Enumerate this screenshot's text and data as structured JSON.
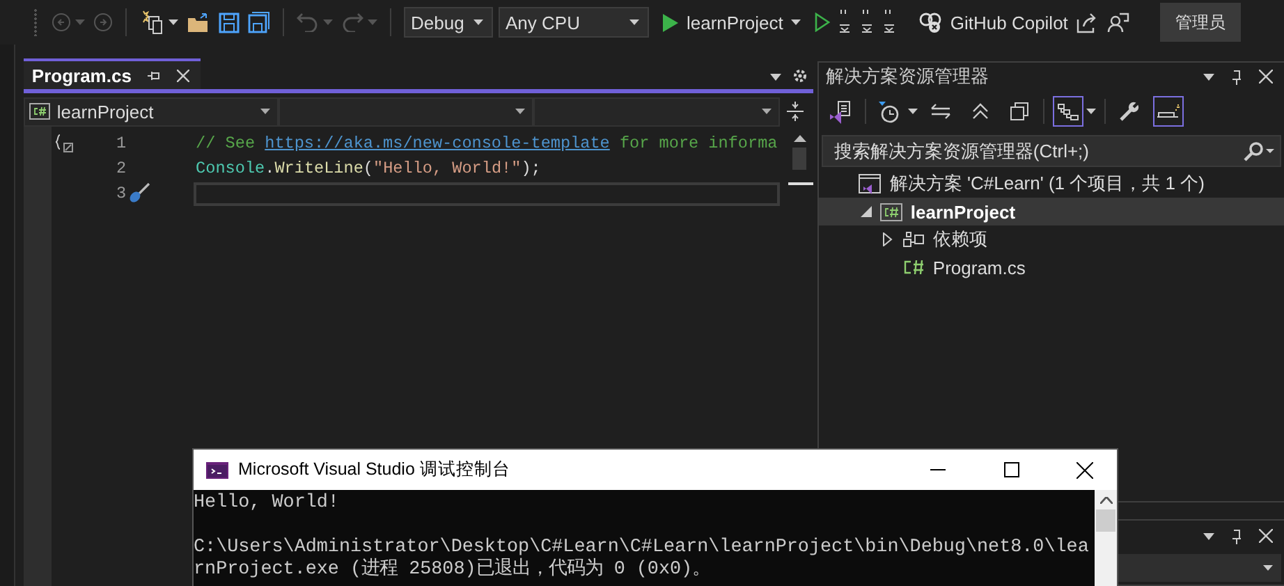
{
  "toolbar": {
    "back_disabled": true,
    "forward_disabled": true,
    "undo_disabled": true,
    "redo_disabled": true,
    "configuration": "Debug",
    "platform": "Any CPU",
    "startup": "learnProject",
    "copilot": "GitHub Copilot",
    "account": "管理员"
  },
  "editor": {
    "tabs": [
      {
        "label": "Program.cs",
        "selected": true
      }
    ],
    "nav": {
      "project": "learnProject"
    },
    "lines": [
      {
        "number": "1",
        "tokens": [
          {
            "text": "// See ",
            "kind": "comment"
          },
          {
            "text": "https://aka.ms/new-console-template",
            "kind": "link"
          },
          {
            "text": " for more informa",
            "kind": "comment"
          }
        ]
      },
      {
        "number": "2",
        "tokens": [
          {
            "text": "Console",
            "kind": "type"
          },
          {
            "text": ".",
            "kind": "plain"
          },
          {
            "text": "WriteLine",
            "kind": "method"
          },
          {
            "text": "(",
            "kind": "plain"
          },
          {
            "text": "\"Hello, World!\"",
            "kind": "string"
          },
          {
            "text": ");",
            "kind": "plain"
          }
        ]
      },
      {
        "number": "3",
        "current": true
      }
    ]
  },
  "solution_explorer": {
    "title": "解决方案资源管理器",
    "tools": [
      {
        "kind": "vs",
        "on": false
      },
      {
        "kind": "history",
        "on": false
      },
      {
        "kind": "sync",
        "on": false
      },
      {
        "kind": "collapse",
        "on": false
      },
      {
        "kind": "copy",
        "on": false
      },
      {
        "kind": "tree",
        "on": true
      },
      {
        "kind": "wrench",
        "on": false
      },
      {
        "kind": "preview",
        "on": true
      }
    ],
    "search": {
      "placeholder": "搜索解决方案资源管理器(Ctrl+;)"
    },
    "tree": [
      {
        "label": "解决方案 'C#Learn' (1 个项目，共 1 个)",
        "kind": "solution",
        "selected": false,
        "children": [
          {
            "label": "learnProject",
            "kind": "project",
            "selected": true,
            "expanded": true,
            "children": [
              {
                "label": "依赖项",
                "kind": "deps",
                "selected": false,
                "expanded": false
              },
              {
                "label": "Program.cs",
                "kind": "file",
                "selected": false
              }
            ]
          }
        ]
      }
    ]
  },
  "console": {
    "title": "Microsoft Visual Studio 调试控制台",
    "paragraphs": [
      [
        "Hello, World!"
      ],
      [
        "C:\\Users\\Administrator\\Desktop\\C#Learn\\C#Learn\\learnProject\\bin\\Debug\\net8.0\\lea",
        "rnProject.exe (进程 25808)已退出，代码为 0 (0x0)。"
      ]
    ]
  }
}
